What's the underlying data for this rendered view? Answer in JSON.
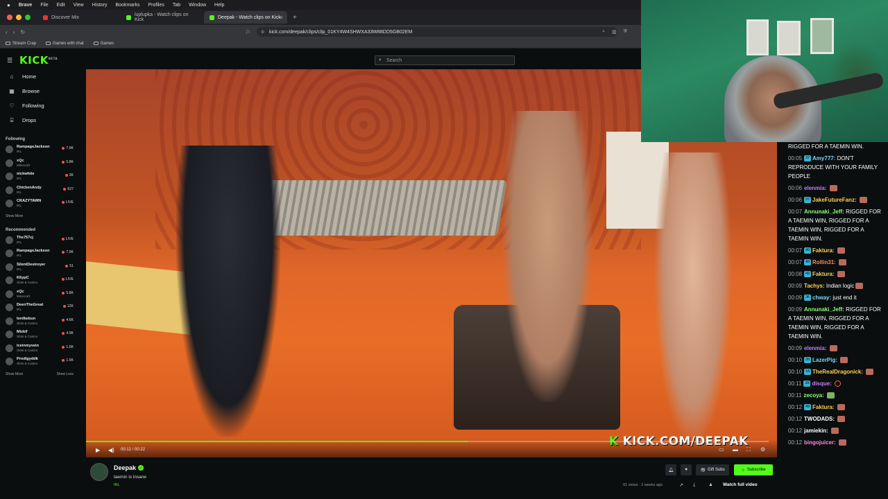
{
  "menubar": {
    "app": "Brave",
    "items": [
      "File",
      "Edit",
      "View",
      "History",
      "Bookmarks",
      "Profiles",
      "Tab",
      "Window",
      "Help"
    ]
  },
  "tabs": [
    {
      "label": "Discover Mix",
      "active": false
    },
    {
      "label": "luplupka - Watch clips on Kick",
      "active": false
    },
    {
      "label": "Deepak - Watch clips on Kick",
      "active": true
    }
  ],
  "address": {
    "url": "kick.com/deepak/clips/clip_01KY4W4SHWXA33W88DD5GB02EM"
  },
  "bookmarks": [
    "Stream Crap",
    "Games with chat",
    "Games"
  ],
  "kick": {
    "logo": "KICK",
    "logo_sup": "BETA",
    "search_placeholder": "Search"
  },
  "nav": [
    {
      "label": "Home",
      "icon": "home-icon"
    },
    {
      "label": "Browse",
      "icon": "browse-icon"
    },
    {
      "label": "Following",
      "icon": "heart-icon"
    },
    {
      "label": "Drops",
      "icon": "drops-icon"
    }
  ],
  "following": {
    "title": "Following",
    "channels": [
      {
        "name": "RampageJackson",
        "category": "IRL",
        "viewers": "7.9K"
      },
      {
        "name": "xQc",
        "category": "Minecraft",
        "viewers": "5.8K"
      },
      {
        "name": "nickwhite",
        "category": "IRL",
        "viewers": "3K"
      },
      {
        "name": "ChickenAndy",
        "category": "IRL",
        "viewers": "627"
      },
      {
        "name": "CRAZYTAWN",
        "category": "IRL",
        "viewers": "LIVE"
      }
    ],
    "show_more": "Show More"
  },
  "recommended": {
    "title": "Recommended",
    "channels": [
      {
        "name": "The757cj",
        "category": "IRL",
        "viewers": "LIVE"
      },
      {
        "name": "RampageJackson",
        "category": "IRL",
        "viewers": "7.9K"
      },
      {
        "name": "SilentDestroyer",
        "category": "IRL",
        "viewers": "51"
      },
      {
        "name": "K6ypC",
        "category": "Slots & Casino",
        "viewers": "LIVE"
      },
      {
        "name": "xQc",
        "category": "Minecraft",
        "viewers": "5.8K"
      },
      {
        "name": "DeenTheGreat",
        "category": "IRL",
        "viewers": "12K"
      },
      {
        "name": "lordkebun",
        "category": "Slots & Casino",
        "viewers": "4.6K"
      },
      {
        "name": "Mizkif",
        "category": "Slots & Casino",
        "viewers": "4.9K"
      },
      {
        "name": "iceinmyvein",
        "category": "Slots & Casino",
        "viewers": "1.6K"
      },
      {
        "name": "Prodigyddk",
        "category": "Slots & Casino",
        "viewers": "1.6K"
      }
    ],
    "show_more": "Show More",
    "show_less": "Show Less"
  },
  "video": {
    "watermark_prefix": "K",
    "watermark": "KICK.COM/DEEPAK",
    "timecode": "00:12 / 00:22",
    "progress": 0.56
  },
  "clip": {
    "channel": "Deepak",
    "title": "taemin is insane",
    "tag": "IRL",
    "gift_label": "Gift Subs",
    "subscribe_label": "Subscribe",
    "views": "91 views · 2 weeks ago",
    "watch_full": "Watch full video"
  },
  "chat": [
    {
      "ts": "",
      "badge": "",
      "user": "",
      "color": "#ffffff",
      "text": "RIGGED FOR A TAEMIN WIN.",
      "emote": ""
    },
    {
      "ts": "00:05",
      "badge": "37",
      "user": "Amy777:",
      "color": "#7ed6ff",
      "text": "DON'T REPRODUCE WITH YOUR FAMILY PEOPLE",
      "emote": ""
    },
    {
      "ts": "00:06",
      "badge": "",
      "user": "elenmia:",
      "color": "#c97bff",
      "text": "",
      "emote": "r"
    },
    {
      "ts": "00:06",
      "badge": "37",
      "user": "JakeFutureFanz:",
      "color": "#ffd34d",
      "text": "",
      "emote": "r"
    },
    {
      "ts": "00:07",
      "badge": "",
      "user": "Annunaki_Jeff:",
      "color": "#8cff7a",
      "text": "RIGGED FOR A TAEMIN WIN, RIGGED FOR A TAEMIN WIN, RIGGED FOR A TAEMIN WIN.",
      "emote": ""
    },
    {
      "ts": "00:07",
      "badge": "49",
      "user": "Faktura:",
      "color": "#ffd34d",
      "text": "",
      "emote": "r"
    },
    {
      "ts": "00:07",
      "badge": "49",
      "user": "Rollin31:",
      "color": "#ff8a5c",
      "text": "",
      "emote": "r"
    },
    {
      "ts": "00:08",
      "badge": "49",
      "user": "Faktura:",
      "color": "#ffd34d",
      "text": "",
      "emote": "r"
    },
    {
      "ts": "00:09",
      "badge": "",
      "user": "Tachys:",
      "color": "#ffd34d",
      "text": "Indian logic",
      "emote": "r"
    },
    {
      "ts": "00:09",
      "badge": "36",
      "user": "chway:",
      "color": "#7ed6ff",
      "text": "just end it",
      "emote": ""
    },
    {
      "ts": "00:09",
      "badge": "",
      "user": "Annunaki_Jeff:",
      "color": "#8cff7a",
      "text": "RIGGED FOR A TAEMIN WIN, RIGGED FOR A TAEMIN WIN, RIGGED FOR A TAEMIN WIN.",
      "emote": ""
    },
    {
      "ts": "00:09",
      "badge": "",
      "user": "elenmia:",
      "color": "#c97bff",
      "text": "",
      "emote": "r"
    },
    {
      "ts": "00:10",
      "badge": "39",
      "user": "LazerPig:",
      "color": "#7ed6ff",
      "text": "",
      "emote": "r"
    },
    {
      "ts": "00:10",
      "badge": "18",
      "user": "TheRealDragonick:",
      "color": "#ffd34d",
      "text": "",
      "emote": "r"
    },
    {
      "ts": "00:11",
      "badge": "39",
      "user": "disque:",
      "color": "#c97bff",
      "text": "",
      "emote": "o"
    },
    {
      "ts": "00:11",
      "badge": "",
      "user": "zecoya:",
      "color": "#8cff7a",
      "text": "",
      "emote": "g"
    },
    {
      "ts": "00:12",
      "badge": "49",
      "user": "Faktura:",
      "color": "#ffd34d",
      "text": "",
      "emote": "r"
    },
    {
      "ts": "00:12",
      "badge": "",
      "user": "TWODADS:",
      "color": "#ffffff",
      "text": "",
      "emote": "r"
    },
    {
      "ts": "00:12",
      "badge": "",
      "user": "jamiekin:",
      "color": "#ffffff",
      "text": "",
      "emote": "r"
    },
    {
      "ts": "00:12",
      "badge": "",
      "user": "bingojuicer:",
      "color": "#ff8ad6",
      "text": "",
      "emote": "r"
    }
  ],
  "colors": {
    "kick_green": "#53fc18",
    "bg": "#0b0e0f",
    "live_red": "#ff4d4d"
  }
}
